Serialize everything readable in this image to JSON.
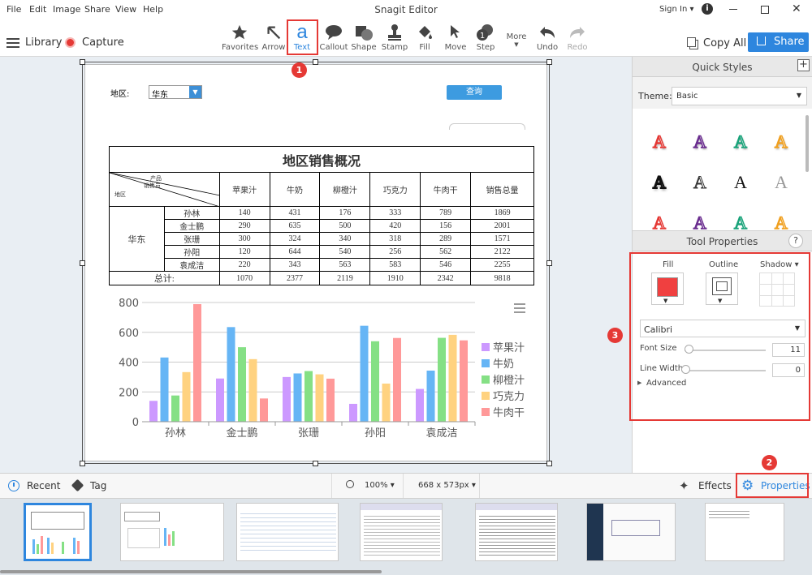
{
  "menu": {
    "items": [
      "File",
      "Edit",
      "Image",
      "Share",
      "View",
      "Help"
    ],
    "title": "Snagit Editor",
    "sign_in": "Sign In ▾"
  },
  "toolbar": {
    "library": "Library",
    "capture": "Capture",
    "tools": [
      {
        "label": "Favorites"
      },
      {
        "label": "Arrow"
      },
      {
        "label": "Text"
      },
      {
        "label": "Callout"
      },
      {
        "label": "Shape"
      },
      {
        "label": "Stamp"
      },
      {
        "label": "Fill"
      },
      {
        "label": "Move"
      },
      {
        "label": "Step"
      },
      {
        "label": "More"
      },
      {
        "label": "Undo"
      },
      {
        "label": "Redo"
      }
    ],
    "copy_all": "Copy All",
    "share": "Share"
  },
  "capture": {
    "region_label": "地区:",
    "region_value": "华东",
    "query_button": "查询",
    "table_title": "地区销售概况",
    "diag_product": "产品",
    "diag_seller": "销售员",
    "diag_region": "地区",
    "headers": [
      "苹果汁",
      "牛奶",
      "柳橙汁",
      "巧克力",
      "牛肉干",
      "销售总量"
    ],
    "region": "华东",
    "rows": [
      {
        "name": "孙林",
        "vals": [
          "140",
          "431",
          "176",
          "333",
          "789",
          "1869"
        ]
      },
      {
        "name": "金士鹏",
        "vals": [
          "290",
          "635",
          "500",
          "420",
          "156",
          "2001"
        ]
      },
      {
        "name": "张珊",
        "vals": [
          "300",
          "324",
          "340",
          "318",
          "289",
          "1571"
        ]
      },
      {
        "name": "孙阳",
        "vals": [
          "120",
          "644",
          "540",
          "256",
          "562",
          "2122"
        ]
      },
      {
        "name": "袁成洁",
        "vals": [
          "220",
          "343",
          "563",
          "583",
          "546",
          "2255"
        ]
      }
    ],
    "total_label": "总计:",
    "totals": [
      "1070",
      "2377",
      "2119",
      "1910",
      "2342",
      "9818"
    ]
  },
  "chart_data": {
    "type": "bar",
    "categories": [
      "孙林",
      "金士鹏",
      "张珊",
      "孙阳",
      "袁成洁"
    ],
    "series": [
      {
        "name": "苹果汁",
        "color": "#cc99ff",
        "values": [
          140,
          290,
          300,
          120,
          220
        ]
      },
      {
        "name": "牛奶",
        "color": "#66b5f5",
        "values": [
          431,
          635,
          324,
          644,
          343
        ]
      },
      {
        "name": "柳橙汁",
        "color": "#85e085",
        "values": [
          176,
          500,
          340,
          540,
          563
        ]
      },
      {
        "name": "巧克力",
        "color": "#ffd280",
        "values": [
          333,
          420,
          318,
          256,
          583
        ]
      },
      {
        "name": "牛肉干",
        "color": "#ff9999",
        "values": [
          789,
          156,
          289,
          562,
          546
        ]
      }
    ],
    "ylim": [
      0,
      800
    ],
    "yticks": [
      "0",
      "200",
      "400",
      "600",
      "800"
    ],
    "grid": true,
    "legend": "right"
  },
  "quick_styles": {
    "title": "Quick Styles",
    "theme_label": "Theme:",
    "theme_value": "Basic"
  },
  "tool_properties": {
    "title": "Tool Properties",
    "help": "?",
    "fill": "Fill",
    "outline": "Outline",
    "shadow": "Shadow ▾",
    "fill_color": "#f04040",
    "font": "Calibri",
    "font_size_label": "Font Size",
    "font_size": "11",
    "line_width_label": "Line Width",
    "line_width": "0",
    "advanced": "Advanced"
  },
  "bottom": {
    "recent": "Recent",
    "tag": "Tag",
    "zoom": "100% ▾",
    "dimensions": "668 x 573px ▾",
    "effects": "Effects",
    "properties": "Properties"
  },
  "badges": {
    "b1": "1",
    "b2": "2",
    "b3": "3"
  },
  "colors": {
    "accent": "#2e86de",
    "annotation": "#e53935"
  }
}
